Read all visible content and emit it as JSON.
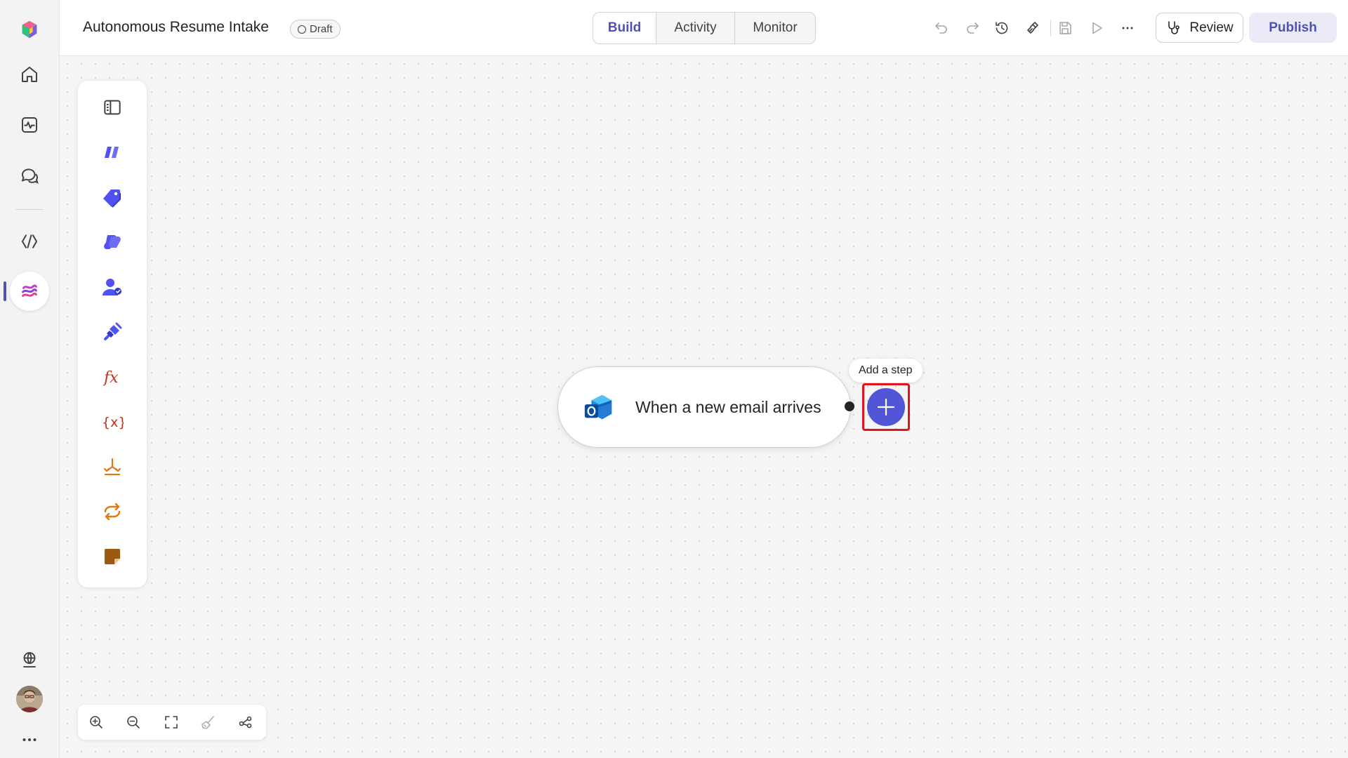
{
  "header": {
    "title": "Autonomous Resume Intake",
    "status_badge": "Draft",
    "tabs": [
      {
        "label": "Build",
        "active": true
      },
      {
        "label": "Activity",
        "active": false
      },
      {
        "label": "Monitor",
        "active": false
      }
    ],
    "icons": [
      "undo-icon",
      "redo-icon",
      "version-history-icon",
      "connections-icon",
      "save-icon",
      "test-run-icon",
      "more-options-icon"
    ],
    "review_label": "Review",
    "publish_label": "Publish"
  },
  "rail": {
    "items": [
      {
        "icon": "app-logo-icon"
      },
      {
        "icon": "home-icon"
      },
      {
        "icon": "activity-icon"
      },
      {
        "icon": "chat-icon"
      },
      {
        "icon": "developer-icon"
      },
      {
        "icon": "agent-flows-icon",
        "active": true
      },
      {
        "icon": "environment-icon"
      },
      {
        "icon": "user-avatar"
      },
      {
        "icon": "more-icon"
      }
    ]
  },
  "toolbox": {
    "items": [
      {
        "name": "collapse-panel-icon"
      },
      {
        "name": "ai-actions-icon",
        "color": "#4f52f0"
      },
      {
        "name": "tags-icon",
        "color": "#4f52f0"
      },
      {
        "name": "copilot-icon",
        "color": "#4f52f0"
      },
      {
        "name": "human-in-loop-icon",
        "color": "#4f52f0"
      },
      {
        "name": "connector-icon",
        "color": "#4f52f0"
      },
      {
        "name": "function-icon",
        "color": "#c3331b"
      },
      {
        "name": "variable-icon",
        "color": "#c3331b"
      },
      {
        "name": "condition-icon",
        "color": "#e5790f"
      },
      {
        "name": "loop-icon",
        "color": "#e5790f"
      },
      {
        "name": "note-icon",
        "color": "#9a5a10"
      }
    ]
  },
  "canvas": {
    "trigger": {
      "label": "When a new email arrives",
      "icon": "outlook-icon"
    },
    "add_step_tooltip": "Add a step"
  },
  "zoom_controls": [
    "zoom-in-icon",
    "zoom-out-icon",
    "fit-view-icon",
    "clean-up-icon",
    "auto-layout-icon"
  ],
  "colors": {
    "accent": "#4f52b2",
    "add_button": "#5156d8",
    "highlight": "#e0141e"
  }
}
